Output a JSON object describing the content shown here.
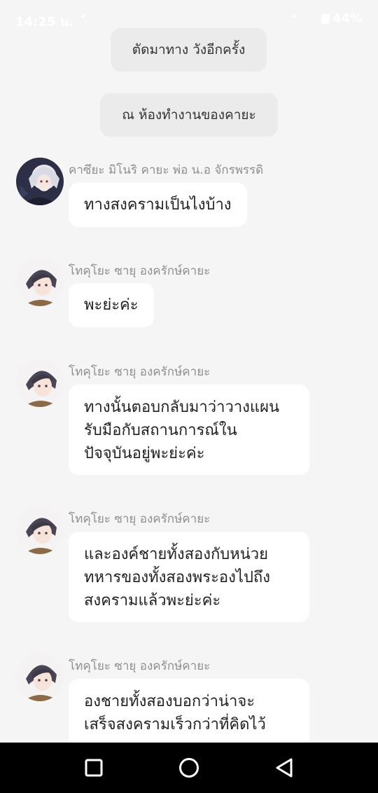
{
  "status_bar": {
    "time": "14:25 น.",
    "battery": "44%"
  },
  "narrations": [
    "ตัดมาทาง วังอีกครั้ง",
    "ณ ห้องทำงานของคายะ"
  ],
  "messages": [
    {
      "sender": "คาซึยะ มิโนริ คายะ พ่อ น.อ จักรพรรดิ",
      "text": "ทางสงครามเป็นไงบ้าง",
      "avatar": "white-hair-avatar"
    },
    {
      "sender": "โทคุโยะ ซายุ องครักษ์คายะ",
      "text": "พะย่ะค่ะ",
      "avatar": "dark-hair-avatar"
    },
    {
      "sender": "โทคุโยะ ซายุ องครักษ์คายะ",
      "lines": [
        "ทางนั้นตอบกลับมาว่าวางแผน",
        "รับมือกับสถานการณ์ใน",
        "ปัจจุบันอยู่พะย่ะค่ะ"
      ],
      "avatar": "dark-hair-avatar"
    },
    {
      "sender": "โทคุโยะ ซายุ องครักษ์คายะ",
      "lines": [
        "และองค์ชายทั้งสองกับหน่วย",
        "ทหารของทั้งสองพระองไปถึง",
        "สงครามแล้วพะย่ะค่ะ"
      ],
      "avatar": "dark-hair-avatar"
    },
    {
      "sender": "โทคุโยะ ซายุ องครักษ์คายะ",
      "lines": [
        "องชายทั้งสองบอกว่าน่าจะ",
        "เสร็จสงครามเร็วกว่าที่คิดไว้"
      ],
      "avatar": "dark-hair-avatar"
    }
  ],
  "nav": {
    "recents": "square-icon",
    "home": "circle-icon",
    "back": "triangle-back-icon"
  }
}
